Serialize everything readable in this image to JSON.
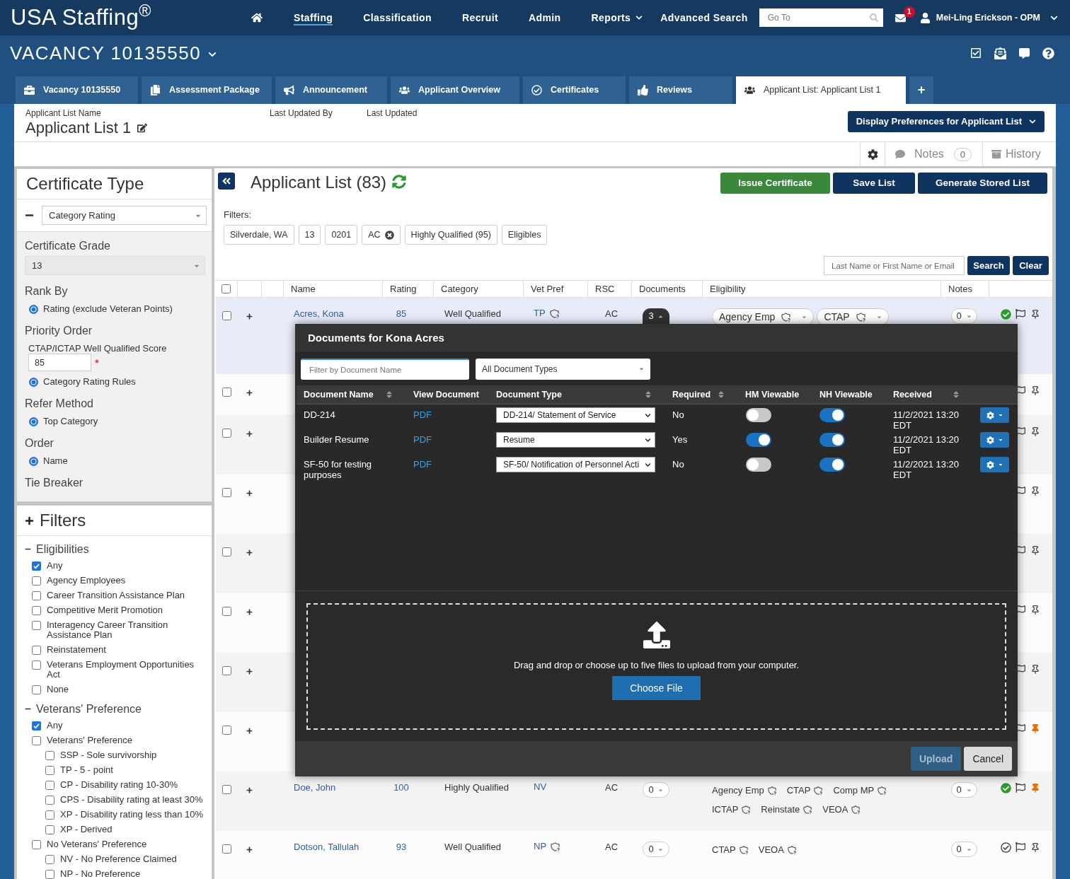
{
  "top_nav": {
    "logo": "USA Staffing$^{®}$",
    "items": [
      {
        "label": "Staffing",
        "selected": true,
        "menu": false
      },
      {
        "label": "Classification",
        "selected": false,
        "menu": false
      },
      {
        "label": "Recruit",
        "selected": false,
        "menu": false
      },
      {
        "label": "Admin",
        "selected": false,
        "menu": false
      },
      {
        "label": "Reports",
        "selected": false,
        "menu": true
      },
      {
        "label": "Advanced Search",
        "selected": false,
        "menu": false
      }
    ],
    "goto": {
      "placeholder": "Go To"
    },
    "message_count": "1",
    "user": "Mei-Ling Erickson - OPM"
  },
  "vacancy": {
    "title": "VACANCY 10135550"
  },
  "tabs": [
    {
      "kind": "vacancy",
      "label": "Vacancy 10135550",
      "selected": false
    },
    {
      "kind": "assessment",
      "label": "Assessment Package",
      "selected": false
    },
    {
      "kind": "announcement",
      "label": "Announcement",
      "selected": false
    },
    {
      "kind": "overview",
      "label": "Applicant Overview",
      "selected": false
    },
    {
      "kind": "certificates",
      "label": "Certificates",
      "selected": false
    },
    {
      "kind": "reviews",
      "label": "Reviews",
      "selected": false
    },
    {
      "kind": "list",
      "label": "Applicant List: Applicant List 1",
      "selected": true
    },
    {
      "kind": "add",
      "label": "+",
      "selected": false
    }
  ],
  "list_header": {
    "name_label": "Applicant List Name",
    "name": "Applicant List 1",
    "updated_by_label": "Last Updated By",
    "updated_label": "Last Updated",
    "preferences_button": "Display Preferences for Applicant List"
  },
  "toolbar": {
    "notes": "Notes",
    "notes_count": "0",
    "history": "History"
  },
  "certificate_panel": {
    "title": "Certificate Type",
    "type": "Category Rating",
    "sections": [
      {
        "kind": "select",
        "label": "Certificate Grade",
        "value": "13",
        "disabled": true
      },
      {
        "kind": "radio",
        "label": "Rank By",
        "options": [
          {
            "label": "Rating (exclude Veteran Points)",
            "selected": true
          }
        ]
      },
      {
        "kind": "radio",
        "label": "Priority Order",
        "score": {
          "label": "CTAP/ICTAP Well Qualified Score",
          "value": "85",
          "required": true
        },
        "options": [
          {
            "label": "Category Rating Rules",
            "selected": true
          }
        ]
      },
      {
        "kind": "radio",
        "label": "Refer Method",
        "options": [
          {
            "label": "Top Category",
            "selected": true
          }
        ]
      },
      {
        "kind": "radio",
        "label": "Order",
        "options": [
          {
            "label": "Name",
            "selected": true
          }
        ]
      },
      {
        "kind": "heading",
        "label": "Tie Breaker"
      }
    ]
  },
  "filters_panel": {
    "title": "Filters",
    "groups": [
      {
        "label": "Eligibilities",
        "expanded": true,
        "items": [
          {
            "label": "Any",
            "checked": true
          },
          {
            "label": "Agency Employees",
            "checked": false
          },
          {
            "label": "Career Transition Assistance Plan",
            "checked": false
          },
          {
            "label": "Competitive Merit Promotion",
            "checked": false
          },
          {
            "label": "Interagency Career Transition Assistance Plan",
            "checked": false
          },
          {
            "label": "Reinstatement",
            "checked": false
          },
          {
            "label": "Veterans Employment Opportunities Act",
            "checked": false
          },
          {
            "label": "None",
            "checked": false
          }
        ]
      },
      {
        "label": "Veterans' Preference",
        "expanded": true,
        "items": [
          {
            "label": "Any",
            "checked": true
          },
          {
            "label": "Veterans' Preference",
            "checked": false,
            "children": [
              {
                "label": "SSP - Sole survivorship",
                "checked": false
              },
              {
                "label": "TP - 5 - point",
                "checked": false
              },
              {
                "label": "CP - Disability rating 10-30%",
                "checked": false
              },
              {
                "label": "CPS - Disability rating at least 30%",
                "checked": false
              },
              {
                "label": "XP - Disability rating less than 10%",
                "checked": false
              },
              {
                "label": "XP - Derived",
                "checked": false
              }
            ]
          },
          {
            "label": "No Veterans' Preference",
            "checked": false,
            "children": [
              {
                "label": "NV - No Preference Claimed",
                "checked": false
              },
              {
                "label": "NP - No Preference",
                "checked": false
              }
            ]
          }
        ]
      }
    ]
  },
  "applicant_list": {
    "title": "Applicant List (83)",
    "actions": [
      {
        "label": "Issue Certificate",
        "kind": "success"
      },
      {
        "label": "Save List",
        "kind": "primary"
      },
      {
        "label": "Generate Stored List",
        "kind": "primary"
      }
    ],
    "filters_label": "Filters:",
    "chips": [
      {
        "label": "Silverdale, WA",
        "removable": false
      },
      {
        "label": "13",
        "removable": false
      },
      {
        "label": "0201",
        "removable": false
      },
      {
        "label": "AC",
        "removable": true
      },
      {
        "label": "Highly Qualified (95)",
        "removable": false
      },
      {
        "label": "Eligibles",
        "removable": false
      }
    ],
    "search": {
      "placeholder": "Last Name or First Name or Email"
    },
    "search_button": "Search",
    "clear_button": "Clear",
    "header_checked": false,
    "columns": [
      "Name",
      "Rating",
      "Category",
      "Vet Pref",
      "RSC",
      "Documents",
      "Eligibility",
      "Notes"
    ],
    "rows": [
      {
        "checked": false,
        "active": true,
        "name": "Acres, Kona",
        "rating": "85",
        "category": "Well Qualified",
        "vet_pref": {
          "code": "TP",
          "help": true
        },
        "rsc": "AC",
        "documents": {
          "count": "3",
          "open": true
        },
        "eligibility": [
          {
            "label": "Agency Emp",
            "kind": "dropdown"
          },
          {
            "label": "CTAP",
            "kind": "dropdown"
          }
        ],
        "notes": "0",
        "verified": true,
        "pinned": false
      },
      {
        "checked": false,
        "pinned": false
      },
      {
        "checked": false,
        "pinned": false
      },
      {
        "checked": false,
        "pinned": false
      },
      {
        "checked": false,
        "pinned": false
      },
      {
        "checked": false,
        "pinned": false
      },
      {
        "checked": false,
        "pinned": false
      },
      {
        "checked": false,
        "pinned": true
      },
      {
        "checked": false,
        "active": false,
        "name": "Doe, John",
        "rating": "100",
        "category": "Highly Qualified",
        "vet_pref": {
          "code": "NV",
          "help": false
        },
        "rsc": "AC",
        "documents": {
          "count": "0",
          "open": false
        },
        "eligibility": [
          {
            "label": "Agency Emp",
            "kind": "tag"
          },
          {
            "label": "CTAP",
            "kind": "tag"
          },
          {
            "label": "Comp MP",
            "kind": "tag"
          },
          {
            "label": "ICTAP",
            "kind": "tag"
          },
          {
            "label": "Reinstate",
            "kind": "tag"
          },
          {
            "label": "VEOA",
            "kind": "tag"
          }
        ],
        "notes": "0",
        "verified": true,
        "pinned": true
      },
      {
        "checked": false,
        "active": false,
        "name": "Dotson, Tallulah",
        "rating": "93",
        "category": "Well Qualified",
        "vet_pref": {
          "code": "NP",
          "help": true
        },
        "rsc": "AC",
        "documents": {
          "count": "0",
          "open": false
        },
        "eligibility": [
          {
            "label": "CTAP",
            "kind": "tag"
          },
          {
            "label": "VEOA",
            "kind": "tag"
          }
        ],
        "notes": "0",
        "verified": false,
        "pinned": false
      }
    ]
  },
  "documents_modal": {
    "title": "Documents for Kona Acres",
    "filter_placeholder": "Filter by Document Name",
    "type_filter": "All Document Types",
    "columns": [
      {
        "label": "Document Name",
        "sortable": true
      },
      {
        "label": "View Document",
        "sortable": false
      },
      {
        "label": "Document Type",
        "sortable": true
      },
      {
        "label": "Required",
        "sortable": true
      },
      {
        "label": "HM Viewable",
        "sortable": false
      },
      {
        "label": "NH Viewable",
        "sortable": false
      },
      {
        "label": "Received",
        "sortable": true
      }
    ],
    "rows": [
      {
        "name": "DD-214",
        "view": "PDF",
        "type": "DD-214/ Statement of Service",
        "required": "No",
        "hm_viewable": false,
        "nh_viewable": true,
        "received": "11/2/2021 13:20 EDT"
      },
      {
        "name": "Builder Resume",
        "view": "PDF",
        "type": "Resume",
        "required": "Yes",
        "hm_viewable": true,
        "nh_viewable": true,
        "received": "11/2/2021 13:20 EDT"
      },
      {
        "name": "SF-50 for testing purposes",
        "view": "PDF",
        "type": "SF-50/ Notification of Personnel Acti",
        "required": "No",
        "hm_viewable": false,
        "nh_viewable": true,
        "received": "11/2/2021 13:20 EDT"
      }
    ],
    "upload": {
      "text": "Drag and drop or choose up to five files to upload from your computer.",
      "choose": "Choose File"
    },
    "buttons": [
      {
        "label": "Upload",
        "kind": "primary",
        "disabled": true
      },
      {
        "label": "Cancel",
        "kind": "secondary",
        "disabled": false
      }
    ]
  }
}
